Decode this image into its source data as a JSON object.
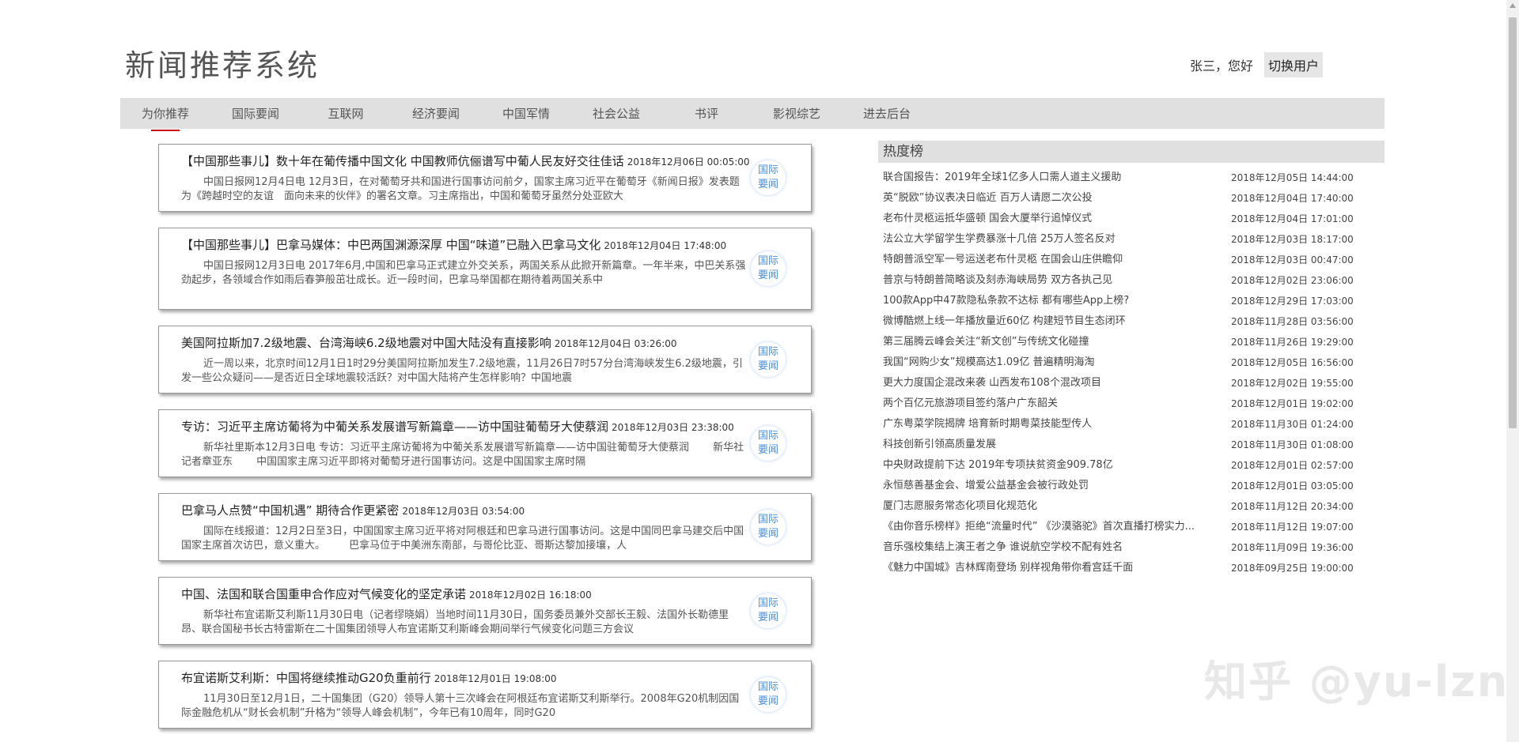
{
  "header": {
    "site_title": "新闻推荐系统",
    "greeting": "张三，您好",
    "switch_user_label": "切换用户"
  },
  "nav": {
    "items": [
      "为你推荐",
      "国际要闻",
      "互联网",
      "经济要闻",
      "中国军情",
      "社会公益",
      "书评",
      "影视综艺",
      "进去后台"
    ],
    "active_index": 0
  },
  "news": [
    {
      "title": "【中国那些事儿】数十年在葡传播中国文化 中国教师伉俪谱写中葡人民友好交往佳话",
      "date": "2018年12月06日 00:05:00",
      "summary": "中国日报网12月4日电 12月3日，在对葡萄牙共和国进行国事访问前夕，国家主席习近平在葡萄牙《新闻日报》发表题为《跨越时空的友谊　面向未来的伙伴》的署名文章。习主席指出，中国和葡萄牙虽然分处亚欧大",
      "tag": "国际要闻"
    },
    {
      "title": "【中国那些事儿】巴拿马媒体：中巴两国渊源深厚 中国“味道”已融入巴拿马文化",
      "date": "2018年12月04日 17:48:00",
      "summary": "中国日报网12月3日电 2017年6月,中国和巴拿马正式建立外交关系，两国关系从此掀开新篇章。一年半来，中巴关系强劲起步，各领域合作如雨后春笋般茁壮成长。近一段时间，巴拿马举国都在期待着两国关系中",
      "tag": "国际要闻"
    },
    {
      "title": "美国阿拉斯加7.2级地震、台湾海峡6.2级地震对中国大陆没有直接影响",
      "date": "2018年12月04日 03:26:00",
      "summary": "近一周以来，北京时间12月1日1时29分美国阿拉斯加发生7.2级地震，11月26日7时57分台湾海峡发生6.2级地震，引发一些公众疑问——是否近日全球地震较活跃？对中国大陆将产生怎样影响？中国地震",
      "tag": "国际要闻"
    },
    {
      "title": "专访：习近平主席访葡将为中葡关系发展谱写新篇章——访中国驻葡萄牙大使蔡润",
      "date": "2018年12月03日 23:38:00",
      "summary": "新华社里斯本12月3日电 专访：习近平主席访葡将为中葡关系发展谱写新篇章——访中国驻葡萄牙大使蔡润 　　新华社记者章亚东 　　中国国家主席习近平即将对葡萄牙进行国事访问。这是中国国家主席时隔",
      "tag": "国际要闻"
    },
    {
      "title": "巴拿马人点赞“中国机遇” 期待合作更紧密",
      "date": "2018年12月03日 03:54:00",
      "summary": "国际在线报道：12月2日至3日，中国国家主席习近平将对阿根廷和巴拿马进行国事访问。这是中国同巴拿马建交后中国国家主席首次访巴，意义重大。 　　巴拿马位于中美洲东南部，与哥伦比亚、哥斯达黎加接壤，人",
      "tag": "国际要闻"
    },
    {
      "title": "中国、法国和联合国重申合作应对气候变化的坚定承诺",
      "date": "2018年12月02日 16:18:00",
      "summary": "新华社布宜诺斯艾利斯11月30日电（记者缪晓娟）当地时间11月30日，国务委员兼外交部长王毅、法国外长勒德里昂、联合国秘书长古特雷斯在二十国集团领导人布宜诺斯艾利斯峰会期间举行气候变化问题三方会议",
      "tag": "国际要闻"
    },
    {
      "title": "布宜诺斯艾利斯：中国将继续推动G20负重前行",
      "date": "2018年12月01日 19:08:00",
      "summary": "11月30日至12月1日，二十国集团（G20）领导人第十三次峰会在阿根廷布宜诺斯艾利斯举行。2008年G20机制因国际金融危机从“财长会机制”升格为“领导人峰会机制”，今年已有10周年，同时G20",
      "tag": "国际要闻"
    }
  ],
  "hot": {
    "header": "热度榜",
    "items": [
      {
        "title": "联合国报告：2019年全球1亿多人口需人道主义援助",
        "time": "2018年12月05日 14:44:00"
      },
      {
        "title": "英“脱欧”协议表决日临近 百万人请愿二次公投",
        "time": "2018年12月04日 17:40:00"
      },
      {
        "title": "老布什灵柩运抵华盛顿 国会大厦举行追悼仪式",
        "time": "2018年12月04日 17:01:00"
      },
      {
        "title": "法公立大学留学生学费暴涨十几倍 25万人签名反对",
        "time": "2018年12月03日 18:17:00"
      },
      {
        "title": "特朗普派空军一号运送老布什灵柩 在国会山庄供瞻仰",
        "time": "2018年12月03日 00:47:00"
      },
      {
        "title": "普京与特朗普简略谈及刻赤海峡局势 双方各执己见",
        "time": "2018年12月02日 23:06:00"
      },
      {
        "title": "100款App中47款隐私条款不达标 都有哪些App上榜?",
        "time": "2018年12月29日 17:03:00"
      },
      {
        "title": "微博酷燃上线一年播放量近60亿 构建短节目生态闭环",
        "time": "2018年11月28日 03:56:00"
      },
      {
        "title": "第三届腾云峰会关注“新文创”与传统文化碰撞",
        "time": "2018年11月26日 19:29:00"
      },
      {
        "title": "我国“网购少女”规模高达1.09亿 普遍精明海淘",
        "time": "2018年12月05日 16:56:00"
      },
      {
        "title": "更大力度国企混改来袭 山西发布108个混改项目",
        "time": "2018年12月02日 19:55:00"
      },
      {
        "title": "两个百亿元旅游项目签约落户广东韶关",
        "time": "2018年12月01日 19:02:00"
      },
      {
        "title": "广东粤菜学院揭牌 培育新时期粤菜技能型传人",
        "time": "2018年11月30日 01:24:00"
      },
      {
        "title": "科技创新引领高质量发展",
        "time": "2018年11月30日 01:08:00"
      },
      {
        "title": "中央财政提前下达 2019年专项扶贫资金909.78亿",
        "time": "2018年12月01日 02:57:00"
      },
      {
        "title": "永恒慈善基金会、增爱公益基金会被行政处罚",
        "time": "2018年12月01日 03:05:00"
      },
      {
        "title": "厦门志愿服务常态化项目化规范化",
        "time": "2018年11月12日 20:34:00"
      },
      {
        "title": "《由你音乐榜样》拒绝“流量时代” 《沙漠骆驼》首次直播打榜实力...",
        "time": "2018年11月12日 19:07:00"
      },
      {
        "title": "音乐强校集结上演王者之争 谁说航空学校不配有姓名",
        "time": "2018年11月09日 19:36:00"
      },
      {
        "title": "《魅力中国城》吉林辉南登场 别样视角带你看宫廷千面",
        "time": "2018年09月25日 19:00:00"
      }
    ]
  },
  "watermark": "知乎 @yu-lzn"
}
